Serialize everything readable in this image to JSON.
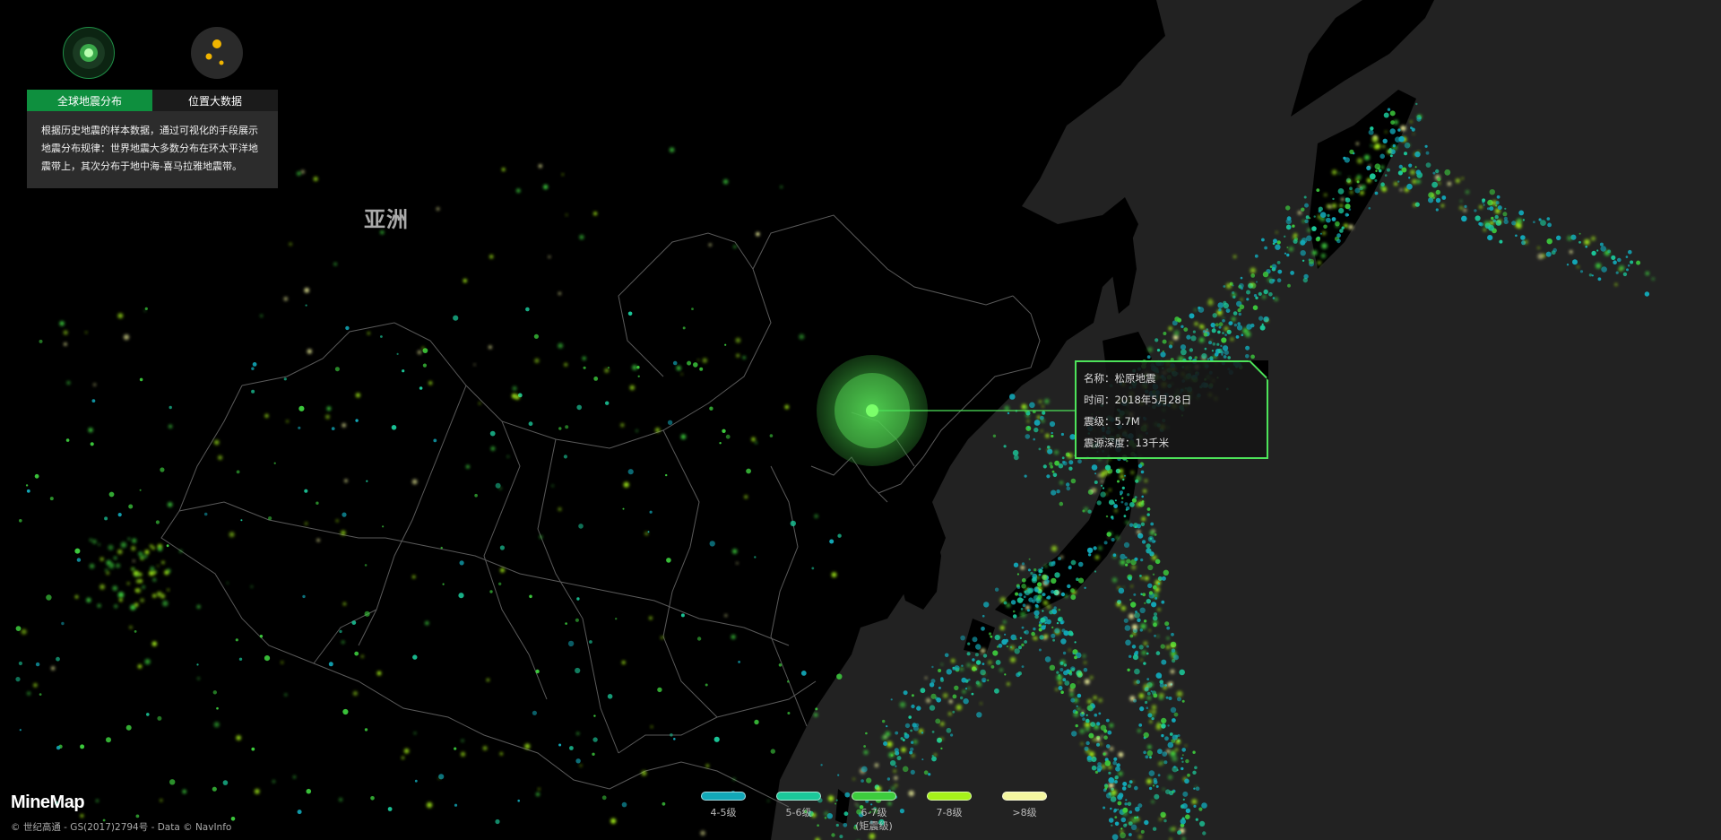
{
  "panel": {
    "tabs": [
      {
        "label": "全球地震分布",
        "active": true
      },
      {
        "label": "位置大数据",
        "active": false
      }
    ],
    "description": "根据历史地震的样本数据，通过可视化的手段展示地震分布规律：世界地震大多数分布在环太平洋地震带上，其次分布于地中海-喜马拉雅地震带。",
    "icons": [
      "global-quake-icon",
      "location-data-icon"
    ]
  },
  "map": {
    "continent_label": "亚洲",
    "colors": {
      "sea": "#222222",
      "land": "#000000",
      "border": "#5a5a5a",
      "accent": "#4de35a"
    }
  },
  "tooltip": {
    "name_label": "名称：",
    "name": "松原地震",
    "time_label": "时间：",
    "time": "2018年5月28日",
    "magnitude_label": "震级：",
    "magnitude": "5.7M",
    "depth_label": "震源深度：",
    "depth": "13千米"
  },
  "legend": [
    {
      "label": "4-5级",
      "sub": "",
      "color": "#12a8b8"
    },
    {
      "label": "5-6级",
      "sub": "",
      "color": "#1bc89a"
    },
    {
      "label": "6-7级",
      "sub": "(矩震级)",
      "color": "#3dcc3d"
    },
    {
      "label": "7-8级",
      "sub": "",
      "color": "#a6f21a"
    },
    {
      "label": ">8级",
      "sub": "",
      "color": "#f4f7a0"
    }
  ],
  "footer": {
    "brand": "MineMap",
    "copyright": "© 世纪高通 - GS(2017)2794号 - Data © NavInfo"
  }
}
